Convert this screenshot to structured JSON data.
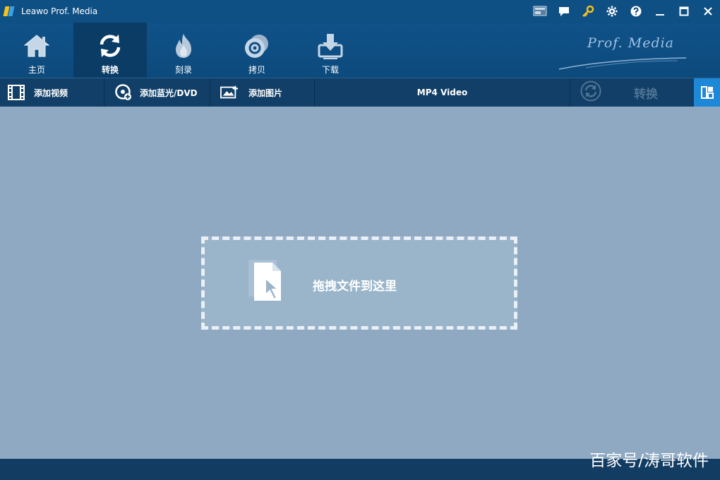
{
  "window": {
    "title": "Leawo Prof. Media",
    "controls": [
      "monitor-icon",
      "feedback-icon",
      "key-icon",
      "gear-icon",
      "help-icon",
      "minimize-icon",
      "maximize-icon",
      "close-icon"
    ]
  },
  "nav": {
    "items": [
      {
        "label": "主页",
        "icon": "home-icon",
        "active": false
      },
      {
        "label": "转换",
        "icon": "convert-icon",
        "active": true
      },
      {
        "label": "刻录",
        "icon": "burn-icon",
        "active": false
      },
      {
        "label": "拷贝",
        "icon": "disc-copy-icon",
        "active": false
      },
      {
        "label": "下载",
        "icon": "download-icon",
        "active": false
      }
    ],
    "brand": "Prof. Media"
  },
  "toolbar": {
    "add_video": "添加视频",
    "add_bluray_dvd": "添加蓝光/DVD",
    "add_photo": "添加图片",
    "format": "MP4 Video",
    "convert": "转换"
  },
  "dropzone": {
    "text": "拖拽文件到这里"
  },
  "watermark": "百家号/涛哥软件",
  "colors": {
    "titlebar": "#0e4f84",
    "nav_active": "#0a3c66",
    "toolbar": "#113f67",
    "content": "#8ea9c1",
    "accent": "#1e88d8",
    "key_icon": "#f4c21b"
  }
}
